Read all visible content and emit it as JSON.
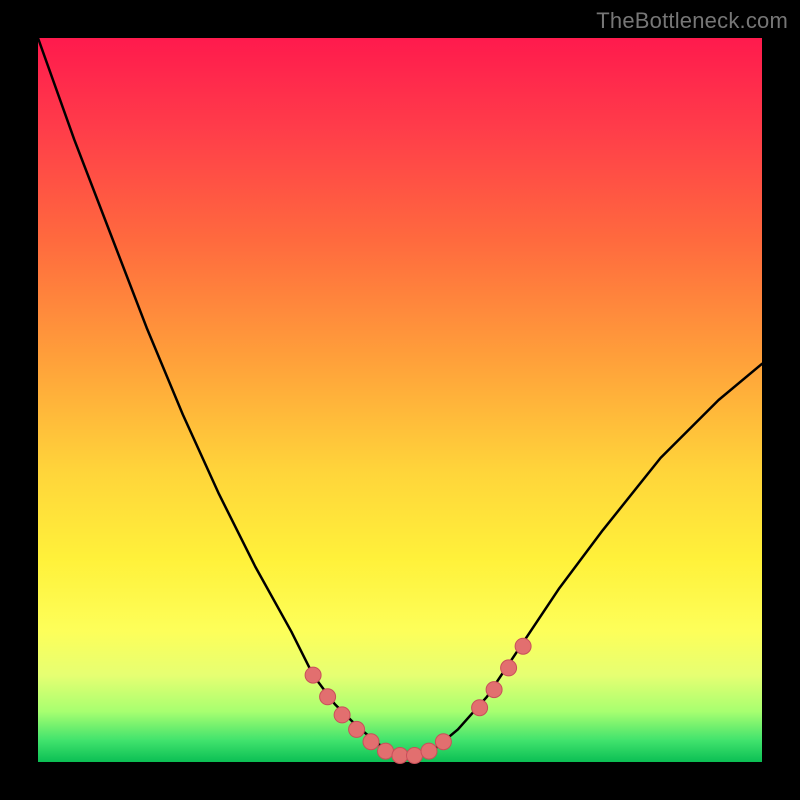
{
  "attribution": "TheBottleneck.com",
  "colors": {
    "curve": "#000000",
    "marker_fill": "#e26f6f",
    "marker_stroke": "#c94f5a",
    "gradient_top": "#ff1a4d",
    "gradient_bottom": "#0bbf54"
  },
  "chart_data": {
    "type": "line",
    "title": "",
    "xlabel": "",
    "ylabel": "",
    "xlim": [
      0,
      100
    ],
    "ylim": [
      0,
      100
    ],
    "grid": false,
    "legend": false,
    "x": [
      0,
      5,
      10,
      15,
      20,
      25,
      30,
      35,
      38,
      41,
      44,
      47,
      49,
      51,
      53,
      55,
      58,
      62,
      66,
      72,
      78,
      86,
      94,
      100
    ],
    "values": [
      100,
      86,
      73,
      60,
      48,
      37,
      27,
      18,
      12,
      8,
      5,
      2.5,
      1.2,
      0.7,
      1.0,
      2.0,
      4.5,
      9,
      15,
      24,
      32,
      42,
      50,
      55
    ],
    "markers": [
      {
        "x": 38,
        "y": 12
      },
      {
        "x": 40,
        "y": 9
      },
      {
        "x": 42,
        "y": 6.5
      },
      {
        "x": 44,
        "y": 4.5
      },
      {
        "x": 46,
        "y": 2.8
      },
      {
        "x": 48,
        "y": 1.5
      },
      {
        "x": 50,
        "y": 0.9
      },
      {
        "x": 52,
        "y": 0.9
      },
      {
        "x": 54,
        "y": 1.5
      },
      {
        "x": 56,
        "y": 2.8
      },
      {
        "x": 61,
        "y": 7.5
      },
      {
        "x": 63,
        "y": 10
      },
      {
        "x": 65,
        "y": 13
      },
      {
        "x": 67,
        "y": 16
      }
    ],
    "annotations": []
  }
}
